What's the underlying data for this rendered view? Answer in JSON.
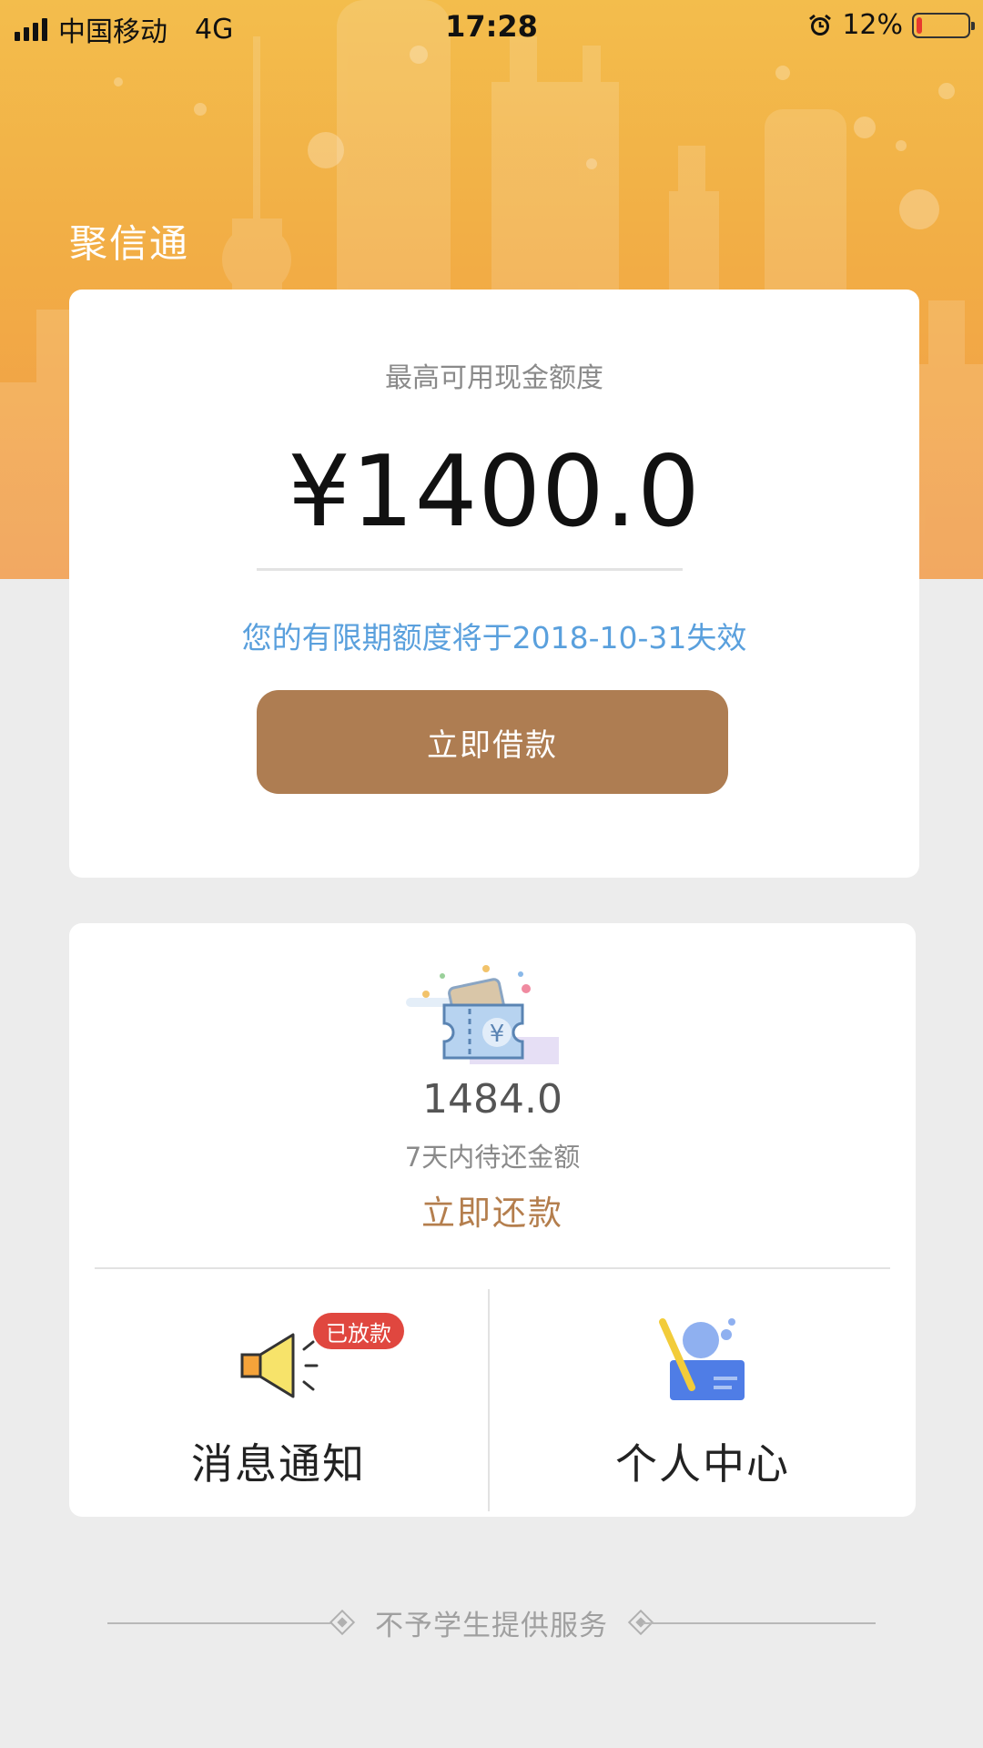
{
  "status_bar": {
    "carrier": "中国移动",
    "network": "4G",
    "time": "17:28",
    "battery": "12%",
    "battery_level": 0.12,
    "icons": [
      "signal-icon",
      "alarm-icon",
      "battery-icon"
    ]
  },
  "app": {
    "title": "聚信通"
  },
  "credit_card": {
    "label": "最高可用现金额度",
    "amount": "¥1400.0",
    "expiry_note": "您的有限期额度将于2018-10-31失效",
    "borrow_button": "立即借款"
  },
  "repay_card": {
    "amount": "1484.0",
    "caption": "7天内待还金额",
    "repay_button": "立即还款",
    "tiles": {
      "notify": {
        "label": "消息通知",
        "badge": "已放款",
        "icon": "speaker-icon"
      },
      "profile": {
        "label": "个人中心",
        "icon": "profile-icon"
      }
    }
  },
  "footer": {
    "text": "不予学生提供服务"
  },
  "colors": {
    "header_gradient_top": "#f3bd4c",
    "header_gradient_bottom": "#f09a48",
    "borrow_button": "#ae7d52",
    "repay_link": "#b47e4d",
    "expiry_note": "#5aa0dd",
    "badge": "#e0473f"
  }
}
